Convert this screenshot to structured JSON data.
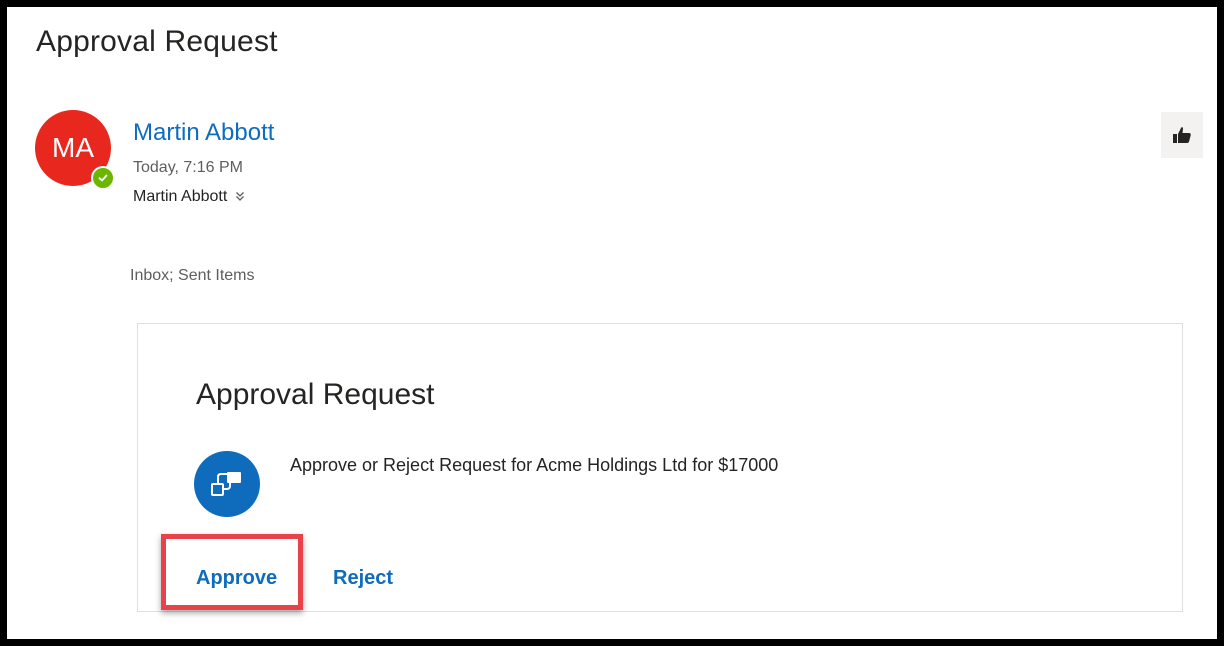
{
  "message": {
    "subject": "Approval Request",
    "sender": {
      "initials": "MA",
      "name": "Martin Abbott",
      "avatar_color": "#e8281e",
      "presence": "available",
      "presence_color": "#6bb700"
    },
    "timestamp": "Today, 7:16 PM",
    "recipient": "Martin Abbott",
    "recipient_chevron_icon": "double-chevron-down-icon",
    "folders": "Inbox; Sent Items",
    "like_icon": "thumbs-up-icon"
  },
  "card": {
    "title": "Approval Request",
    "icon": "power-automate-flow-icon",
    "icon_color": "#0f6cbd",
    "message": "Approve or Reject Request for Acme Holdings Ltd for $17000",
    "actions": {
      "approve_label": "Approve",
      "reject_label": "Reject"
    }
  },
  "annotation": {
    "highlighted_element": "approve-button",
    "highlight_color": "#e8434a"
  },
  "accent_color": "#0f6cbd"
}
